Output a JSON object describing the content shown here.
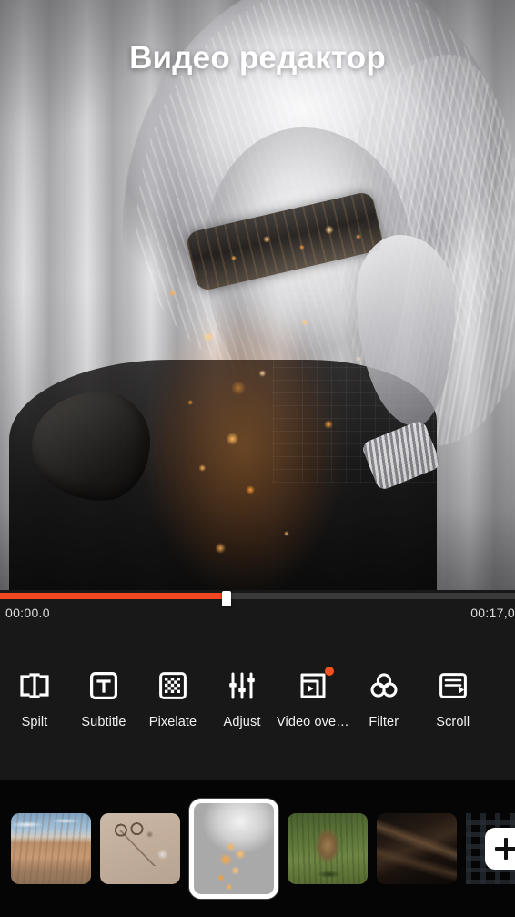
{
  "preview": {
    "title": "Видео редактор",
    "image_description": "double-exposure portrait of woman with flowing hair and sunglasses blended with orange city lights"
  },
  "timeline": {
    "current_time": "00:00.0",
    "total_time": "00:17,0",
    "progress_percent": 44,
    "fill_color": "#f24822",
    "track_color": "#3a3a3a"
  },
  "toolbar": {
    "items": [
      {
        "label": "Spilt",
        "icon": "split-icon",
        "badge": false
      },
      {
        "label": "Subtitle",
        "icon": "subtitle-icon",
        "badge": false
      },
      {
        "label": "Pixelate",
        "icon": "pixelate-icon",
        "badge": false
      },
      {
        "label": "Adjust",
        "icon": "adjust-icon",
        "badge": false
      },
      {
        "label": "Video ove…",
        "icon": "video-overlay-icon",
        "badge": true
      },
      {
        "label": "Filter",
        "icon": "filter-icon",
        "badge": false
      },
      {
        "label": "Scroll",
        "icon": "scroll-icon",
        "badge": false
      }
    ],
    "badge_color": "#f4511e"
  },
  "filmstrip": {
    "clips": [
      {
        "name": "desert-canyon",
        "art": "t-desert",
        "selected": false
      },
      {
        "name": "beige-flatlay",
        "art": "t-flatlay",
        "selected": false
      },
      {
        "name": "portrait-video",
        "art": "t-portrait",
        "selected": true
      },
      {
        "name": "leopard-grass",
        "art": "t-leopard",
        "selected": false
      },
      {
        "name": "dark-abstract",
        "art": "t-dark",
        "selected": false
      },
      {
        "name": "building-grid",
        "art": "t-building",
        "selected": false
      }
    ],
    "add_label": "+"
  }
}
